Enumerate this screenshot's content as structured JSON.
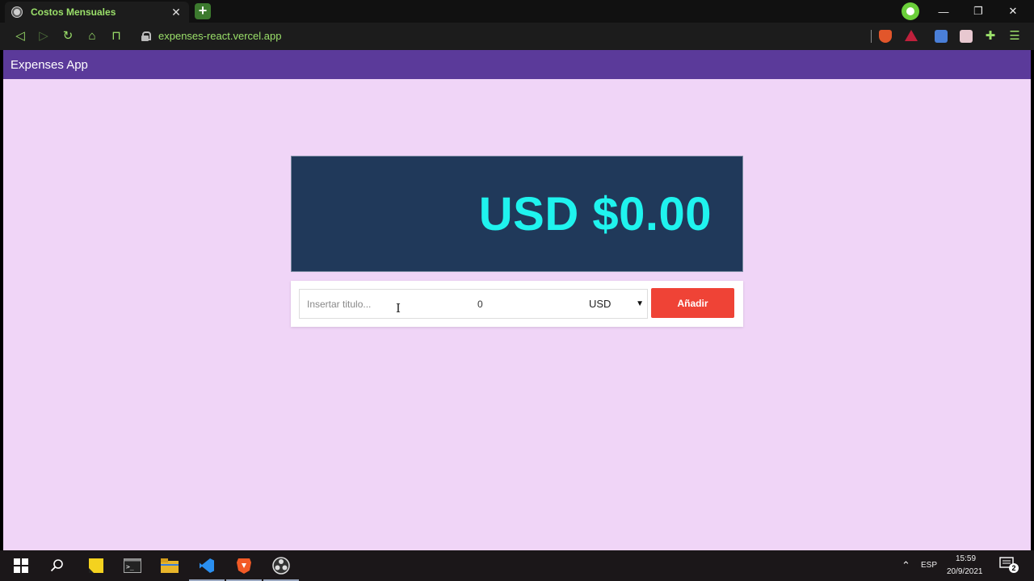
{
  "browser": {
    "tab_title": "Costos Mensuales",
    "tab_close": "✕",
    "new_tab": "+",
    "url": "expenses-react.vercel.app",
    "window_controls": {
      "minimize": "—",
      "restore": "❐",
      "close": "✕"
    }
  },
  "app": {
    "header_title": "Expenses App",
    "total_display": "USD $0.00",
    "form": {
      "title_placeholder": "Insertar titulo...",
      "amount_value": "0",
      "currency_selected": "USD",
      "add_button_label": "Añadir"
    }
  },
  "taskbar": {
    "language": "ESP",
    "time": "15:59",
    "date": "20/9/2021",
    "notification_count": "2"
  },
  "colors": {
    "page_background": "#f0d5f7",
    "header_background": "#5b3a9a",
    "total_card_background": "#20395a",
    "total_text": "#1ff3ee",
    "add_button": "#ef4336",
    "browser_accent": "#9be06a"
  }
}
